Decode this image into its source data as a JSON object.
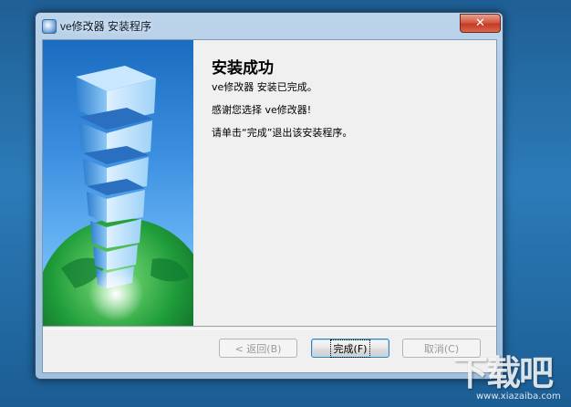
{
  "window": {
    "title": "ve修改器 安装程序",
    "close_glyph": "✕"
  },
  "content": {
    "title": "安装成功",
    "line1": "ve修改器  安装已完成。",
    "line2": "感谢您选择 ve修改器!",
    "line3": "请单击“完成”退出该安装程序。"
  },
  "buttons": {
    "back": "< 返回(B)",
    "finish": "完成(F)",
    "cancel": "取消(C)"
  },
  "watermark": {
    "logo_text": "下载吧",
    "url": "www.xiazaiba.com"
  },
  "colors": {
    "accent_blue": "#3c8fe0",
    "close_red": "#c43a22"
  }
}
